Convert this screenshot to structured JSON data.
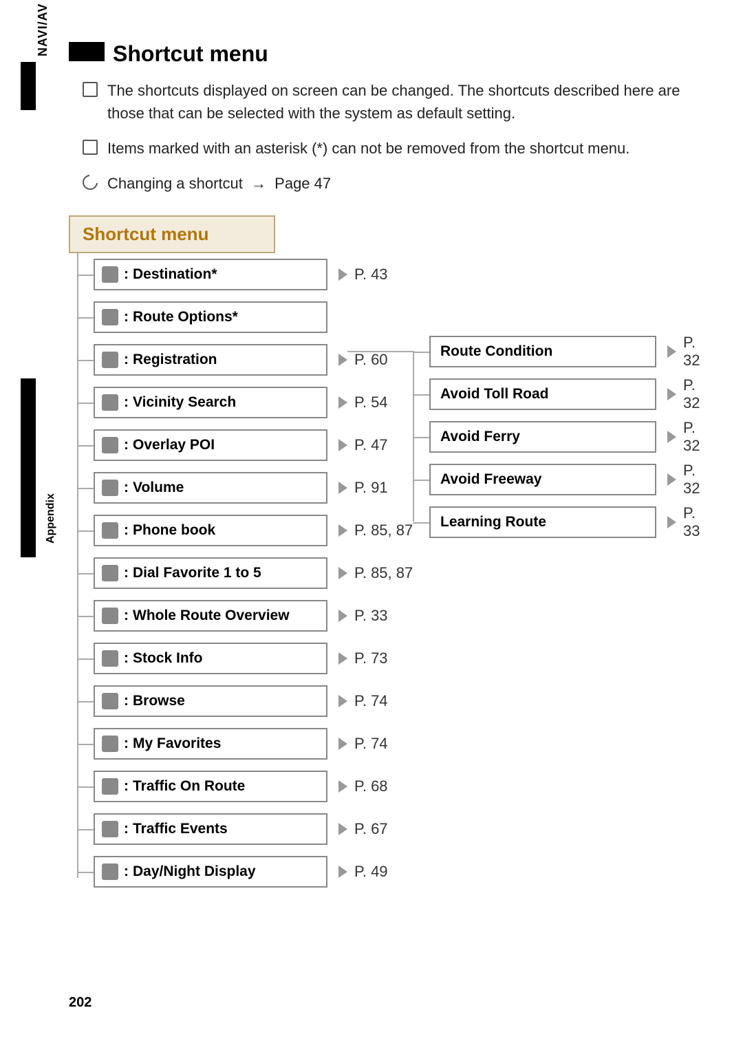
{
  "side": {
    "top": "NAVI/AV",
    "mid": "Appendix"
  },
  "heading": "Shortcut menu",
  "notes": {
    "n1": "The shortcuts displayed on screen can be changed. The shortcuts described here are those that can be selected with the system as default setting.",
    "n2": "Items marked with an asterisk (*) can not be removed from the shortcut menu.",
    "n3a": "Changing a shortcut",
    "n3b": "Page 47"
  },
  "box_title": "Shortcut menu",
  "items": [
    {
      "label": "Destination*",
      "page": "P. 43"
    },
    {
      "label": "Route Options*",
      "page": ""
    },
    {
      "label": "Registration",
      "page": "P. 60"
    },
    {
      "label": "Vicinity Search",
      "page": "P. 54"
    },
    {
      "label": "Overlay POI",
      "page": "P. 47"
    },
    {
      "label": "Volume",
      "page": "P. 91"
    },
    {
      "label": "Phone book",
      "page": "P. 85, 87"
    },
    {
      "label": "Dial Favorite 1 to 5",
      "page": "P. 85, 87"
    },
    {
      "label": "Whole Route Overview",
      "page": "P. 33"
    },
    {
      "label": "Stock Info",
      "page": "P. 73"
    },
    {
      "label": "Browse",
      "page": "P. 74"
    },
    {
      "label": "My Favorites",
      "page": "P. 74"
    },
    {
      "label": "Traffic On Route",
      "page": "P. 68"
    },
    {
      "label": "Traffic Events",
      "page": "P. 67"
    },
    {
      "label": "Day/Night Display",
      "page": "P. 49"
    }
  ],
  "subitems": [
    {
      "label": "Route Condition",
      "page": "P. 32"
    },
    {
      "label": "Avoid Toll Road",
      "page": "P. 32"
    },
    {
      "label": "Avoid Ferry",
      "page": "P. 32"
    },
    {
      "label": "Avoid Freeway",
      "page": "P. 32"
    },
    {
      "label": "Learning Route",
      "page": "P. 33"
    }
  ],
  "page_number": "202"
}
